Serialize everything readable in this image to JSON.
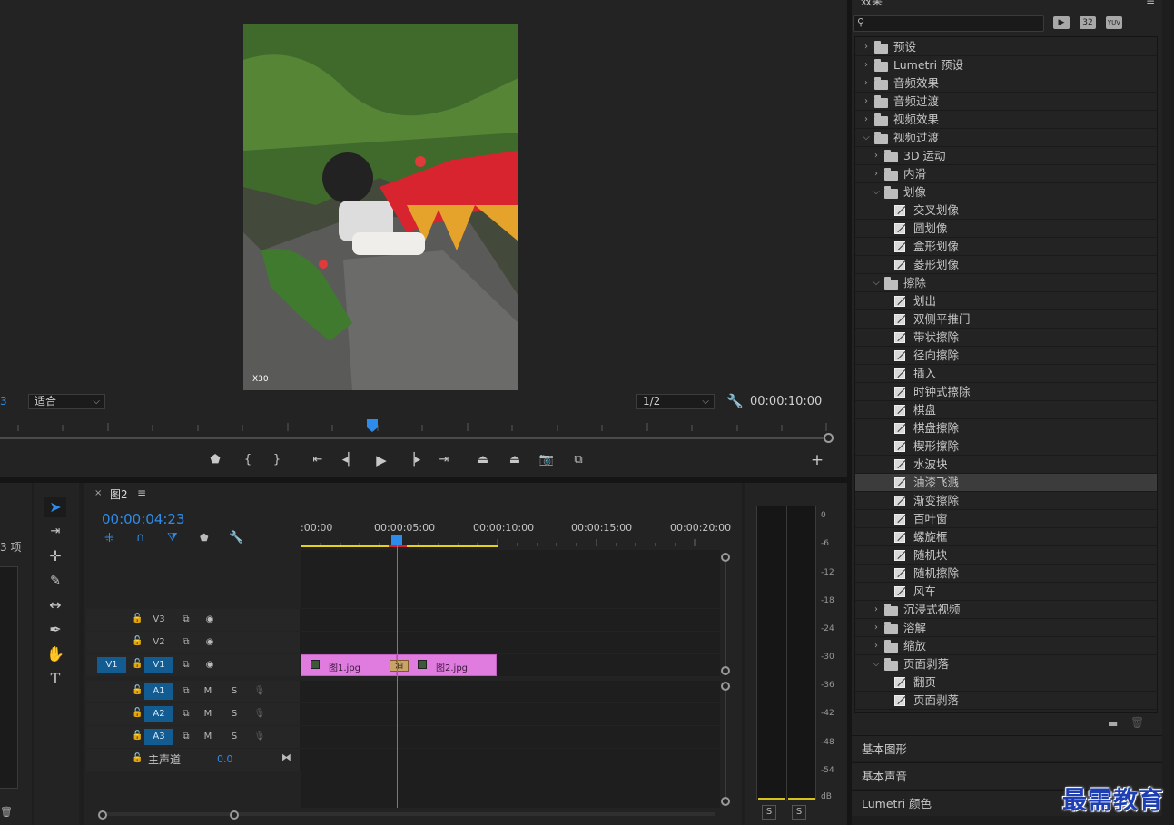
{
  "monitor": {
    "left_edge_number": "3",
    "fit_select": "适合",
    "quality_select": "1/2",
    "duration_timecode": "00:00:10:00",
    "preview_watermark": "X30"
  },
  "timeline": {
    "tab_close": "×",
    "sequence_name": "图2",
    "menu_icon": "≡",
    "current_timecode": "00:00:04:23",
    "ruler_labels": [
      ":00:00",
      "00:00:05:00",
      "00:00:10:00",
      "00:00:15:00",
      "00:00:20:00"
    ],
    "project_items_fragment": "3 项",
    "tracks": {
      "v3": "V3",
      "v2": "V2",
      "v1_source": "V1",
      "v1": "V1",
      "a1": "A1",
      "a2": "A2",
      "a3": "A3",
      "mute": "M",
      "solo": "S",
      "master_label": "主声道",
      "master_value": "0.0"
    },
    "clips": {
      "clip1": "图1.jpg",
      "transition": "油",
      "clip2": "图2.jpg"
    }
  },
  "meter": {
    "db_scale": [
      "0",
      "-6",
      "-12",
      "-18",
      "-24",
      "-30",
      "-36",
      "-42",
      "-48",
      "-54",
      "dB"
    ],
    "solo_left": "S",
    "solo_right": "S"
  },
  "effects": {
    "panel_title": "效果",
    "search_placeholder": "",
    "badge_32": "32",
    "badge_yuv": "YUV",
    "tree": [
      {
        "label": "预设",
        "level": 0,
        "type": "preset",
        "open": false
      },
      {
        "label": "Lumetri 预设",
        "level": 0,
        "type": "preset",
        "open": false
      },
      {
        "label": "音频效果",
        "level": 0,
        "type": "folder",
        "open": false
      },
      {
        "label": "音频过渡",
        "level": 0,
        "type": "folder",
        "open": false
      },
      {
        "label": "视频效果",
        "level": 0,
        "type": "folder",
        "open": false
      },
      {
        "label": "视频过渡",
        "level": 0,
        "type": "folder",
        "open": true
      },
      {
        "label": "3D 运动",
        "level": 1,
        "type": "folder",
        "open": false
      },
      {
        "label": "内滑",
        "level": 1,
        "type": "folder",
        "open": false
      },
      {
        "label": "划像",
        "level": 1,
        "type": "folder",
        "open": true
      },
      {
        "label": "交叉划像",
        "level": 2,
        "type": "fx"
      },
      {
        "label": "圆划像",
        "level": 2,
        "type": "fx"
      },
      {
        "label": "盒形划像",
        "level": 2,
        "type": "fx"
      },
      {
        "label": "菱形划像",
        "level": 2,
        "type": "fx"
      },
      {
        "label": "擦除",
        "level": 1,
        "type": "folder",
        "open": true
      },
      {
        "label": "划出",
        "level": 2,
        "type": "fx"
      },
      {
        "label": "双侧平推门",
        "level": 2,
        "type": "fx"
      },
      {
        "label": "带状擦除",
        "level": 2,
        "type": "fx"
      },
      {
        "label": "径向擦除",
        "level": 2,
        "type": "fx"
      },
      {
        "label": "插入",
        "level": 2,
        "type": "fx"
      },
      {
        "label": "时钟式擦除",
        "level": 2,
        "type": "fx"
      },
      {
        "label": "棋盘",
        "level": 2,
        "type": "fx"
      },
      {
        "label": "棋盘擦除",
        "level": 2,
        "type": "fx"
      },
      {
        "label": "楔形擦除",
        "level": 2,
        "type": "fx"
      },
      {
        "label": "水波块",
        "level": 2,
        "type": "fx"
      },
      {
        "label": "油漆飞溅",
        "level": 2,
        "type": "fx",
        "selected": true
      },
      {
        "label": "渐变擦除",
        "level": 2,
        "type": "fx"
      },
      {
        "label": "百叶窗",
        "level": 2,
        "type": "fx"
      },
      {
        "label": "螺旋框",
        "level": 2,
        "type": "fx"
      },
      {
        "label": "随机块",
        "level": 2,
        "type": "fx"
      },
      {
        "label": "随机擦除",
        "level": 2,
        "type": "fx"
      },
      {
        "label": "风车",
        "level": 2,
        "type": "fx"
      },
      {
        "label": "沉浸式视频",
        "level": 1,
        "type": "folder",
        "open": false
      },
      {
        "label": "溶解",
        "level": 1,
        "type": "folder",
        "open": false
      },
      {
        "label": "缩放",
        "level": 1,
        "type": "folder",
        "open": false
      },
      {
        "label": "页面剥落",
        "level": 1,
        "type": "folder",
        "open": true
      },
      {
        "label": "翻页",
        "level": 2,
        "type": "fx"
      },
      {
        "label": "页面剥落",
        "level": 2,
        "type": "fx"
      }
    ]
  },
  "side_panels": {
    "essential_graphics": "基本图形",
    "essential_sound": "基本声音",
    "lumetri_color": "Lumetri 颜色"
  },
  "watermark": "最需教育",
  "colors": {
    "accent_blue": "#2d8ceb",
    "track_blue": "#125c92",
    "clip_pink": "#e07ce0",
    "work_area_yellow": "#e6d21c"
  }
}
